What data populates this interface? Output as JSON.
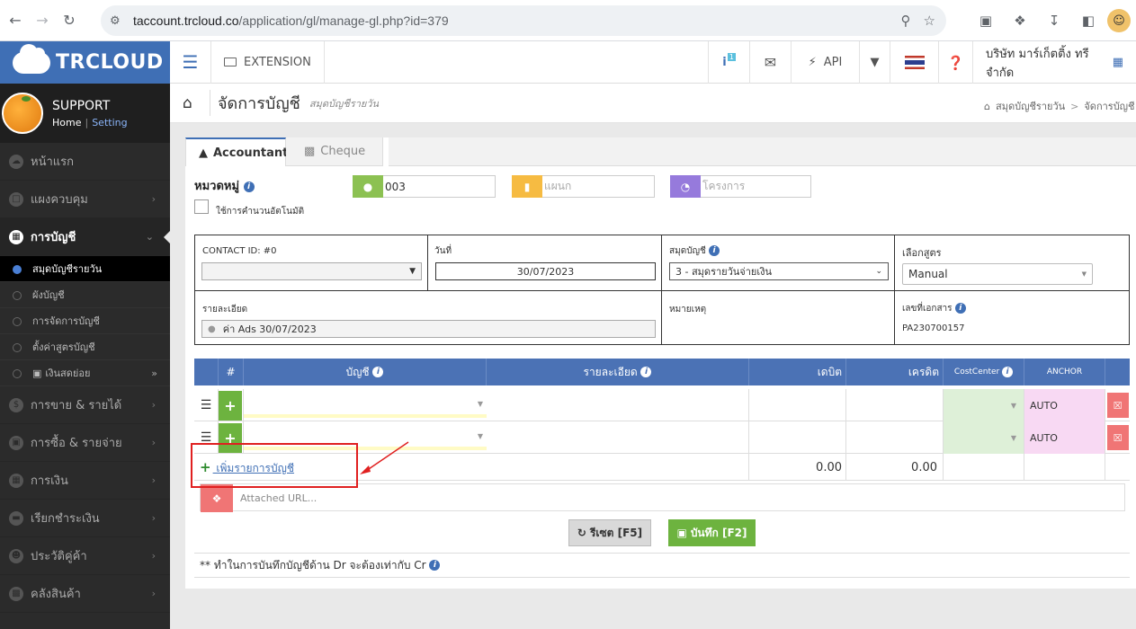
{
  "browser": {
    "url_host": "taccount.trcloud.co",
    "url_path": "/application/gl/manage-gl.php?id=379"
  },
  "brand": {
    "name": "TRCLOUD"
  },
  "user": {
    "name": "SUPPORT",
    "home": "Home",
    "setting": "Setting"
  },
  "sidebar": {
    "items": [
      {
        "label": "หน้าแรก",
        "icon": "home-icon"
      },
      {
        "label": "แผงควบคุม",
        "icon": "monitor-icon"
      },
      {
        "label": "การบัญชี",
        "icon": "book-icon"
      },
      {
        "label": "การขาย & รายได้",
        "icon": "dollar-icon"
      },
      {
        "label": "การซื้อ & รายจ่าย",
        "icon": "cart-icon"
      },
      {
        "label": "การเงิน",
        "icon": "calendar-icon"
      },
      {
        "label": "เรียกชำระเงิน",
        "icon": "card-icon"
      },
      {
        "label": "ประวัติคู่ค้า",
        "icon": "contact-icon"
      },
      {
        "label": "คลังสินค้า",
        "icon": "cubes-icon"
      }
    ],
    "subitems": [
      {
        "label": "สมุดบัญชีรายวัน"
      },
      {
        "label": "ผังบัญชี"
      },
      {
        "label": "การจัดการบัญชี"
      },
      {
        "label": "ตั้งค่าสูตรบัญชี"
      },
      {
        "label": "เงินสดย่อย"
      }
    ]
  },
  "topbar": {
    "extension": "EXTENSION",
    "info_badge": "1",
    "api": "API",
    "company": "บริษัท มาร์เก็ตติ้ง ทรี จำกัด"
  },
  "page": {
    "title": "จัดการบัญชี",
    "subtitle": "สมุดบัญชีรายวัน",
    "crumb_1": "สมุดบัญชีรายวัน",
    "crumb_2": "จัดการบัญชี"
  },
  "tabs": [
    {
      "label": "Accountant"
    },
    {
      "label": "Cheque"
    }
  ],
  "form": {
    "category_label": "หมวดหมู่",
    "auto_number_label": "ใช้การคำนวนอัตโนมัติ",
    "person_value": "003",
    "department_placeholder": "แผนก",
    "project_placeholder": "โครงการ",
    "contact_label": "CONTACT ID: #0",
    "date_label": "วันที่",
    "date_value": "30/07/2023",
    "journal_label": "สมุดบัญชี",
    "journal_value": "3 - สมุดรายวันจ่ายเงิน",
    "formula_label": "เลือกสูตร",
    "formula_value": "Manual",
    "detail_label": "รายละเอียด",
    "detail_value": "ค่า Ads 30/07/2023",
    "remark_label": "หมายเหตุ",
    "docno_label": "เลขที่เอกสาร",
    "docno_value": "PA230700157"
  },
  "grid": {
    "headers": {
      "num": "#",
      "account": "บัญชี",
      "desc": "รายละเอียด",
      "debit": "เดบิต",
      "credit": "เครดิต",
      "cost_center": "CostCenter",
      "anchor": "ANCHOR"
    },
    "rows": [
      {
        "anchor": "AUTO"
      },
      {
        "anchor": "AUTO"
      }
    ],
    "total_debit": "0.00",
    "total_credit": "0.00",
    "add_label": " เพิ่มรายการบัญชี"
  },
  "attach": {
    "placeholder": "Attached URL..."
  },
  "buttons": {
    "reset": "รีเซต [F5]",
    "save": "บันทึก [F2]"
  },
  "note": "** ทำในการบันทึกบัญชีด้าน Dr จะต้องเท่ากับ Cr"
}
